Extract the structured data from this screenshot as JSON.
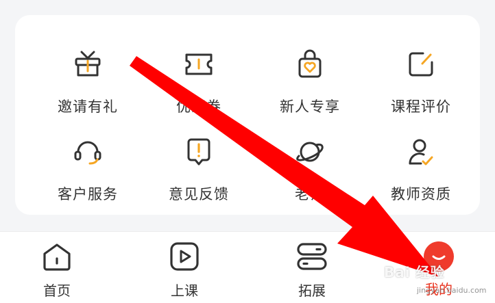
{
  "grid": {
    "items": [
      {
        "label": "邀请有礼",
        "icon": "gift-icon"
      },
      {
        "label": "优惠券",
        "icon": "coupon-icon"
      },
      {
        "label": "新人专享",
        "icon": "shopping-bag-heart-icon"
      },
      {
        "label": "课程评价",
        "icon": "edit-square-icon"
      },
      {
        "label": "客户服务",
        "icon": "headset-icon"
      },
      {
        "label": "意见反馈",
        "icon": "feedback-icon"
      },
      {
        "label": "老师",
        "icon": "planet-icon"
      },
      {
        "label": "教师资质",
        "icon": "teacher-check-icon"
      }
    ]
  },
  "tabbar": {
    "tabs": [
      {
        "label": "首页",
        "icon": "home-icon"
      },
      {
        "label": "上课",
        "icon": "play-icon"
      },
      {
        "label": "拓展",
        "icon": "expand-icon"
      },
      {
        "label": "我的",
        "icon": "profile-icon",
        "active": true
      }
    ]
  },
  "watermark": {
    "main": "Bai 经验",
    "sub": "jingyan.baidu.com"
  },
  "colors": {
    "accent": "#f5a623",
    "icon_stroke": "#333333",
    "active": "#e8321e",
    "arrow": "#ff0000"
  }
}
